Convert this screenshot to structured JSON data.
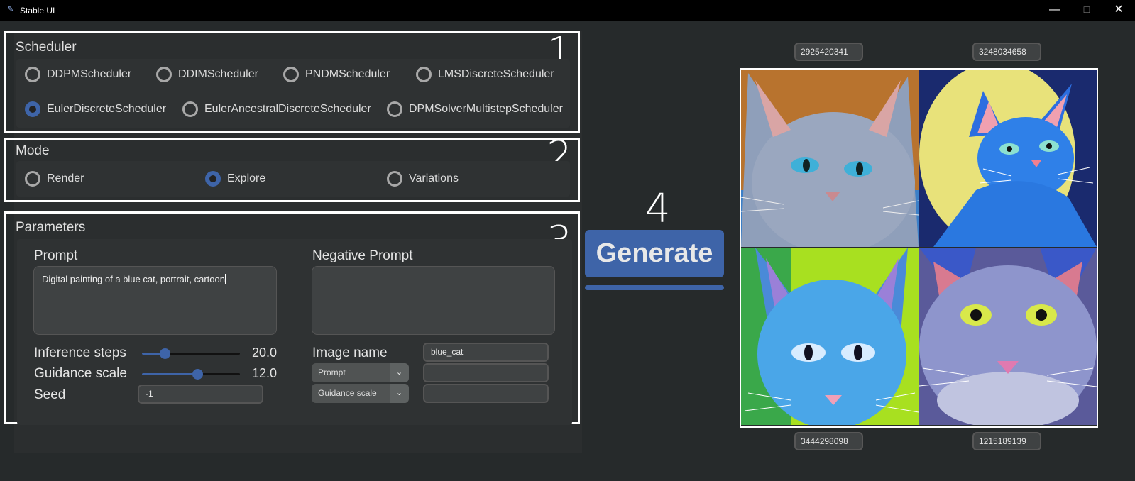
{
  "window": {
    "title": "Stable UI",
    "min": "—",
    "max": "☐",
    "close": "✕"
  },
  "scheduler": {
    "title": "Scheduler",
    "step": "1",
    "options": [
      "DDPMScheduler",
      "DDIMScheduler",
      "PNDMScheduler",
      "LMSDiscreteScheduler",
      "EulerDiscreteScheduler",
      "EulerAncestralDiscreteScheduler",
      "DPMSolverMultistepScheduler"
    ],
    "selected": "EulerDiscreteScheduler"
  },
  "mode": {
    "title": "Mode",
    "step": "2",
    "options": [
      "Render",
      "Explore",
      "Variations"
    ],
    "selected": "Explore"
  },
  "parameters": {
    "title": "Parameters",
    "step": "3",
    "prompt_label": "Prompt",
    "prompt_value": "Digital painting of a blue cat, portrait, cartoon",
    "negative_label": "Negative Prompt",
    "negative_value": "",
    "inference_label": "Inference steps",
    "inference_value": "20.0",
    "inference_fraction": 0.2,
    "guidance_label": "Guidance scale",
    "guidance_value": "12.0",
    "guidance_fraction": 0.58,
    "seed_label": "Seed",
    "seed_value": "-1",
    "image_name_label": "Image name",
    "image_name_value": "blue_cat",
    "combo1": "Prompt",
    "combo1_value": "",
    "combo2": "Guidance scale",
    "combo2_value": ""
  },
  "generate": {
    "step": "4",
    "label": "Generate",
    "progress": 1.0
  },
  "images": {
    "seeds": [
      "2925420341",
      "3248034658",
      "3444298098",
      "1215189139"
    ]
  },
  "icons": {
    "app": "feather-icon",
    "dropdown": "chevron-down-icon"
  }
}
